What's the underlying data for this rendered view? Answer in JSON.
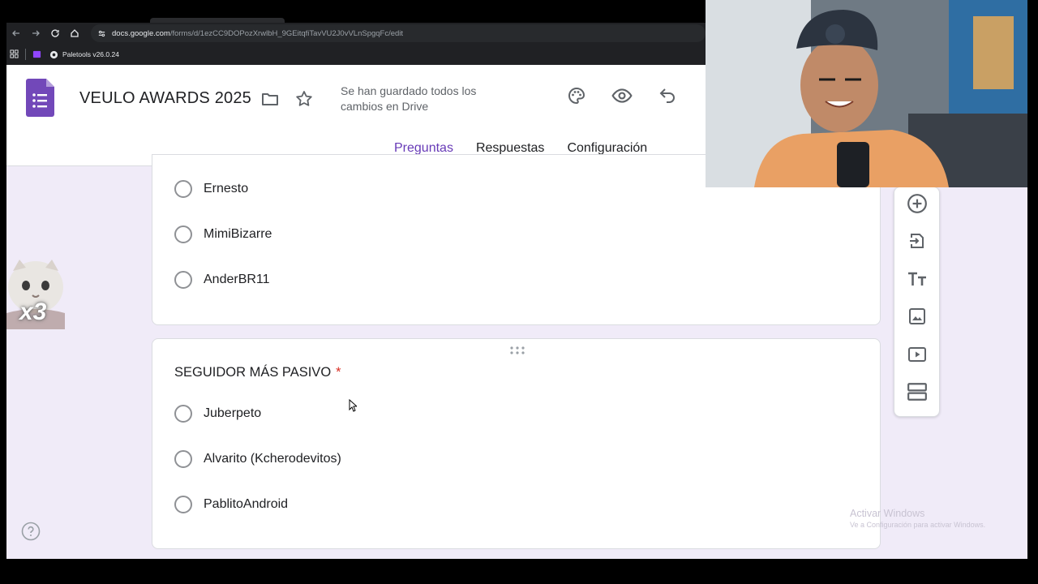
{
  "browser": {
    "url_domain": "docs.google.com",
    "url_path": "/forms/d/1ezCC9DOPozXrwlbH_9GEitqfiTavVU2J0vVLnSpgqFc/edit",
    "bookmark": "Paletools v26.0.24"
  },
  "header": {
    "title": "VEULO AWARDS 2025",
    "save_status": "Se han guardado todos los cambios en Drive",
    "tabs": [
      {
        "label": "Preguntas",
        "active": true
      },
      {
        "label": "Respuestas",
        "active": false
      },
      {
        "label": "Configuración",
        "active": false
      }
    ]
  },
  "question_prev": {
    "options": [
      "Ernesto",
      "MimiBizarre",
      "AnderBR11"
    ]
  },
  "question": {
    "title": "SEGUIDOR MÁS PASIVO",
    "required_mark": "*",
    "options": [
      "Juberpeto",
      "Alvarito (Kcherodevitos)",
      "PablitoAndroid"
    ]
  },
  "sticker": {
    "text": "x3"
  },
  "watermark": {
    "line1": "Activar Windows",
    "line2": "Ve a Configuración para activar Windows."
  },
  "colors": {
    "accent": "#673ab7",
    "page_bg": "#f0ebf8",
    "required": "#d93025"
  },
  "icons": {
    "toolbar": [
      "add-question-icon",
      "import-questions-icon",
      "add-title-icon",
      "add-image-icon",
      "add-video-icon",
      "add-section-icon"
    ],
    "header": [
      "palette-icon",
      "preview-icon",
      "undo-icon",
      "folder-icon",
      "star-icon"
    ]
  }
}
